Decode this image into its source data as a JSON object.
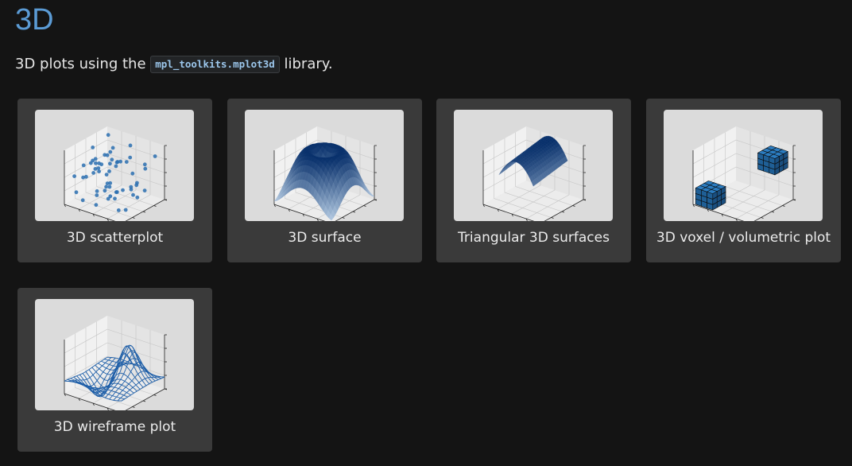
{
  "page": {
    "title": "3D",
    "intro_before": "3D plots using the ",
    "intro_code": "mpl_toolkits.mplot3d",
    "intro_after": " library."
  },
  "gallery": {
    "items": [
      {
        "label": "3D scatterplot",
        "icon": "scatter-3d-thumbnail"
      },
      {
        "label": "3D surface",
        "icon": "surface-3d-thumbnail"
      },
      {
        "label": "Triangular 3D surfaces",
        "icon": "trisurf-3d-thumbnail"
      },
      {
        "label": "3D voxel / volumetric plot",
        "icon": "voxel-3d-thumbnail"
      },
      {
        "label": "3D wireframe plot",
        "icon": "wireframe-3d-thumbnail"
      }
    ]
  },
  "colors": {
    "background": "#141414",
    "card": "#3a3a3a",
    "thumbnail_bg": "#dbdbdb",
    "title_accent": "#5b9bd5",
    "plot_blue": "#1f77b4"
  }
}
